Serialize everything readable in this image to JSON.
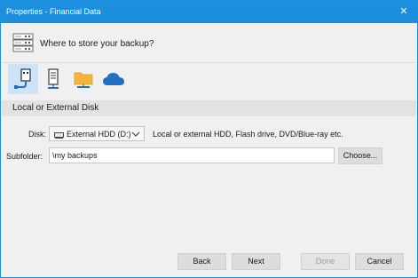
{
  "window": {
    "title": "Properties - Financial Data",
    "close_symbol": "✕"
  },
  "header": {
    "heading": "Where to store your backup?",
    "icon": "backup-drive-icon"
  },
  "destinations": [
    {
      "icon": "usb-drive-icon",
      "selected": true
    },
    {
      "icon": "network-server-icon",
      "selected": false
    },
    {
      "icon": "folder-icon",
      "selected": false
    },
    {
      "icon": "cloud-icon",
      "selected": false
    }
  ],
  "section": {
    "title": "Local or External Disk"
  },
  "disk": {
    "label": "Disk:",
    "selected": "External HDD (D:)",
    "description": "Local or external HDD, Flash drive, DVD/Blue-ray etc."
  },
  "subfolder": {
    "label": "Subfolder:",
    "value": "\\my backups",
    "choose_label": "Choose..."
  },
  "footer": {
    "back_label": "Back",
    "next_label": "Next",
    "done_label": "Done",
    "cancel_label": "Cancel"
  },
  "colors": {
    "titlebar": "#1b8ede",
    "accent_blue": "#1f6fc4",
    "selected_tile": "#cde3f7",
    "folder": "#f2b43a"
  }
}
